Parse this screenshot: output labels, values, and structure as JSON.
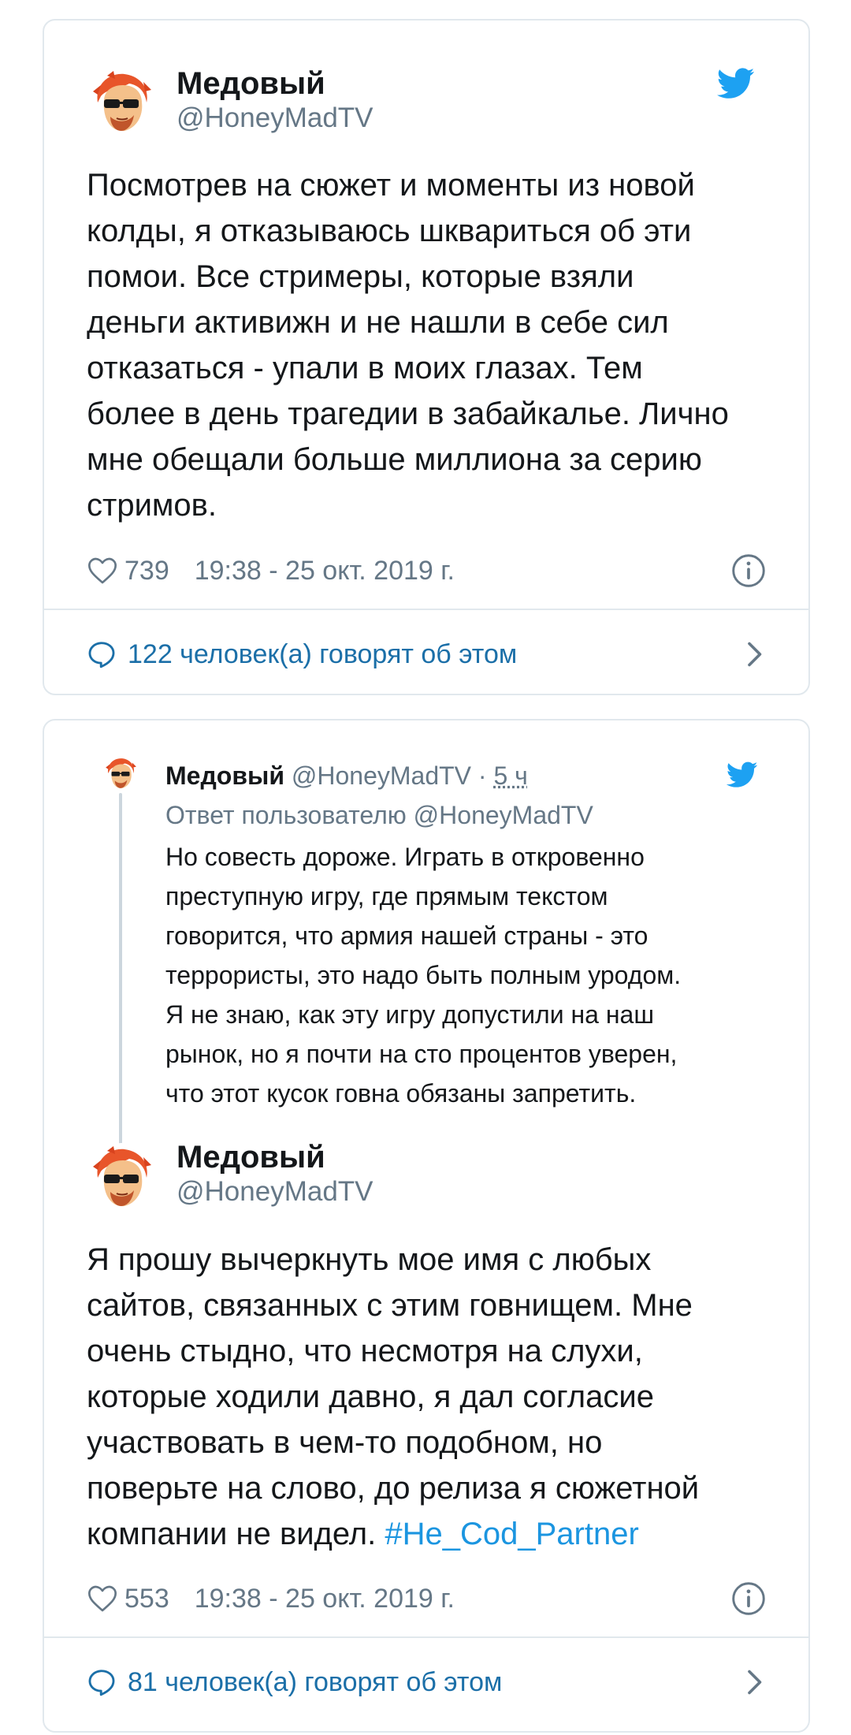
{
  "tweet1": {
    "author_name": "Медовый",
    "author_handle": "@HoneyMadTV",
    "text": "Посмотрев на сюжет и моменты из новой\nколды, я отказываюсь шквариться об эти\nпомои. Все стримеры, которые взяли\nденьги активижн и не нашли в себе сил\nотказаться - упали в моих глазах. Тем\nболее в день трагедии в забайкалье. Лично\nмне обещали больше миллиона за серию\nстримов.",
    "likes": "739",
    "timestamp": "19:38 - 25 окт. 2019 г.",
    "conversation": "122 человек(а) говорят об этом"
  },
  "reply": {
    "author_name": "Медовый",
    "author_handle": "@HoneyMadTV",
    "separator": " · ",
    "time_ago": "5 ч",
    "reply_to": "Ответ пользователю @HoneyMadTV",
    "text": "Но совесть дороже. Играть в откровенно\nпреступную игру, где прямым текстом\nговорится, что армия нашей страны - это\nтеррористы, это надо быть полным уродом.\nЯ не знаю, как эту игру допустили на наш\nрынок, но я почти на сто процентов уверен,\nчто этот кусок говна обязаны запретить."
  },
  "tweet2": {
    "author_name": "Медовый",
    "author_handle": "@HoneyMadTV",
    "text": "Я прошу вычеркнуть мое имя с любых\nсайтов, связанных с этим говнищем. Мне\nочень стыдно, что несмотря на слухи,\nкоторые ходили давно, я дал согласие\nучаствовать в чем-то подобном, но\nповерьте на слово, до релиза я сюжетной\nкомпании не видел. ",
    "hashtag": "#He_Cod_Partner",
    "likes": "553",
    "timestamp": "19:38 - 25 окт. 2019 г.",
    "conversation": "81 человек(а) говорят об этом"
  },
  "icons": {
    "twitter": "twitter-bird-icon",
    "like": "heart-icon",
    "info": "info-icon",
    "reply": "speech-bubble-icon",
    "chevron": "chevron-right-icon"
  },
  "colors": {
    "twitter_blue": "#1da1f2",
    "link_blue": "#1b95e0",
    "muted_text": "#657786",
    "border": "#e1e8ed"
  }
}
